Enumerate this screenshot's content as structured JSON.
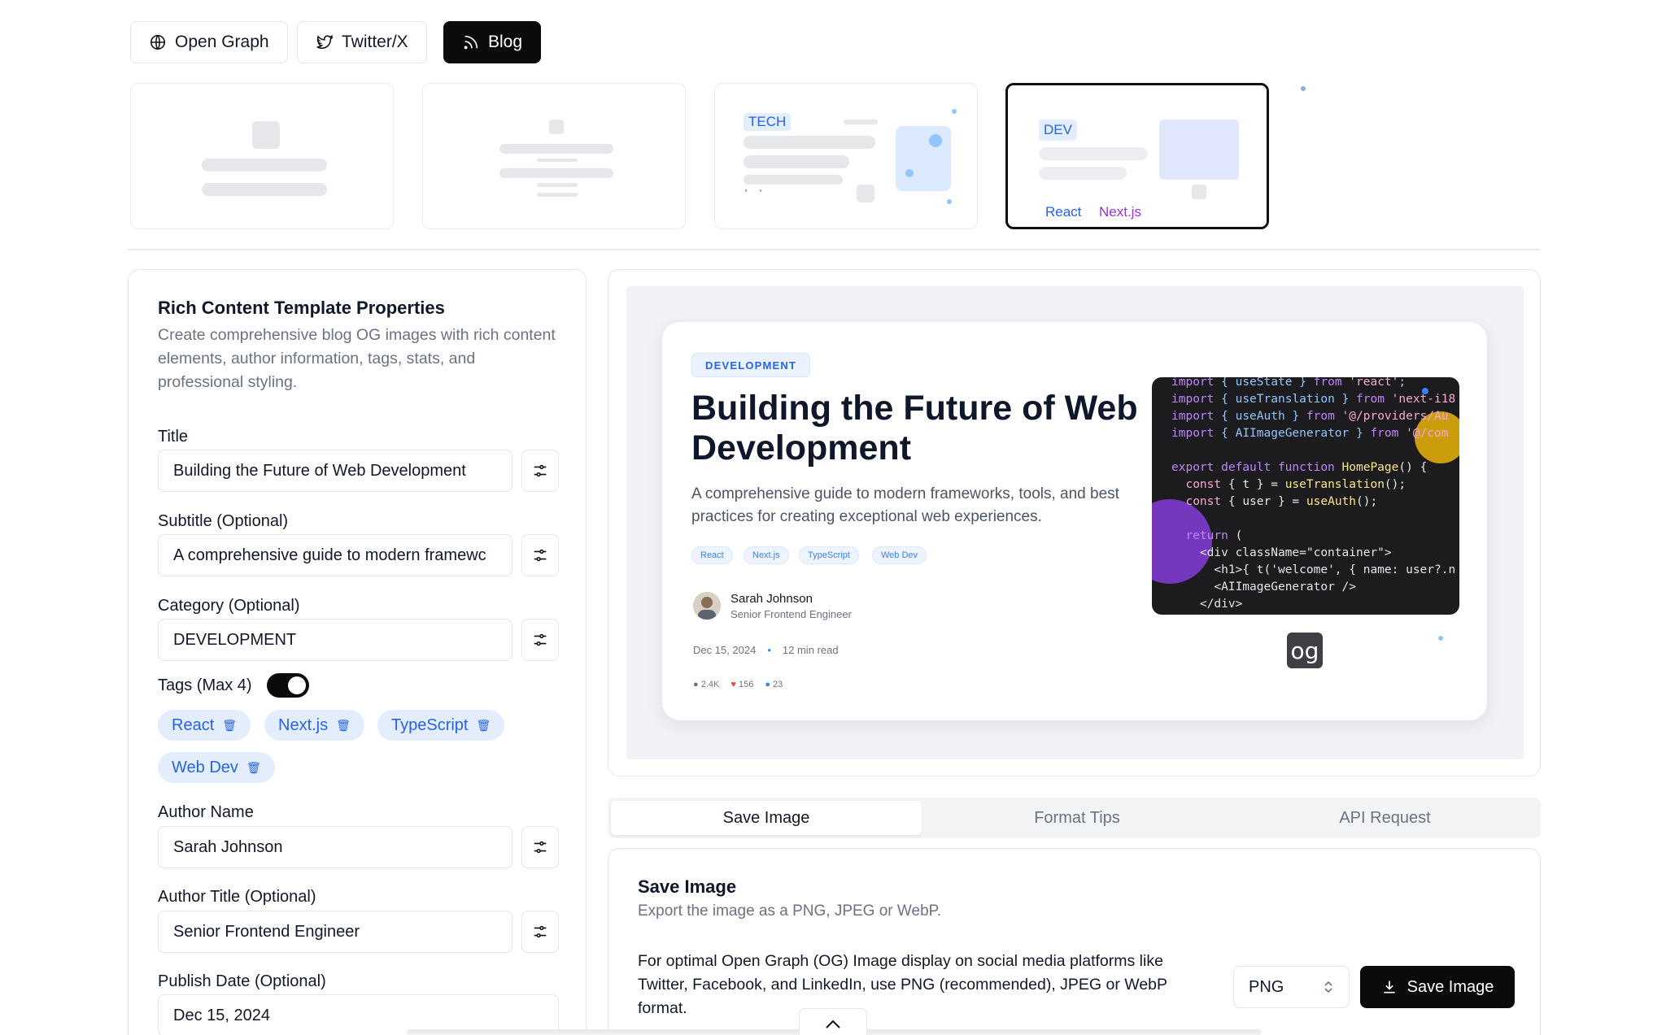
{
  "top_tabs": [
    {
      "label": "Open Graph",
      "icon": "globe-icon",
      "active": false
    },
    {
      "label": "Twitter/X",
      "icon": "twitter-icon",
      "active": false
    },
    {
      "label": "Blog",
      "icon": "rss-icon",
      "active": true
    }
  ],
  "templates": {
    "tech_label": "TECH",
    "dev_label": "DEV",
    "dev_tags": [
      "React",
      "Next.js"
    ]
  },
  "form": {
    "title": "Rich Content Template Properties",
    "description": "Create comprehensive blog OG images with rich content elements, author information, tags, stats, and professional styling.",
    "title_label": "Title",
    "title_value": "Building the Future of Web Development",
    "subtitle_label": "Subtitle (Optional)",
    "subtitle_value": "A comprehensive guide to modern framewc",
    "category_label": "Category (Optional)",
    "category_value": "DEVELOPMENT",
    "tags_label": "Tags (Max 4)",
    "tags_enabled": true,
    "tags": [
      "React",
      "Next.js",
      "TypeScript",
      "Web Dev"
    ],
    "tag_delete_icon": "🗑",
    "author_label": "Author Name",
    "author_value": "Sarah Johnson",
    "author_title_label": "Author Title (Optional)",
    "author_title_value": "Senior Frontend Engineer",
    "date_label": "Publish Date (Optional)",
    "date_value": "Dec 15, 2024"
  },
  "preview": {
    "category": "DEVELOPMENT",
    "title": "Building the Future of Web Development",
    "subtitle": "A comprehensive guide to modern frameworks, tools, and best practices for creating exceptional web experiences.",
    "tags": [
      "React",
      "Next.js",
      "TypeScript",
      "Web Dev"
    ],
    "author": "Sarah Johnson",
    "author_title": "Senior Frontend Engineer",
    "date": "Dec 15, 2024",
    "dot": "•",
    "read_time": "12 min read",
    "stats": {
      "views": "2.4K",
      "likes": "156",
      "comments": "23"
    },
    "logo": "og"
  },
  "bottom_tabs": [
    {
      "label": "Save Image",
      "active": true
    },
    {
      "label": "Format Tips",
      "active": false
    },
    {
      "label": "API Request",
      "active": false
    }
  ],
  "save": {
    "title": "Save Image",
    "description": "Export the image as a PNG, JPEG or WebP.",
    "text": "For optimal Open Graph (OG) Image display on social media platforms like Twitter, Facebook, and LinkedIn, use PNG (recommended), JPEG or WebP format.",
    "format": "PNG",
    "button_label": "Save Image"
  },
  "colors": {
    "accent": "#0b0b0d",
    "tag_bg": "#e3edfc",
    "tag_text": "#2563eb",
    "code_bg": "#1c1c1f"
  }
}
